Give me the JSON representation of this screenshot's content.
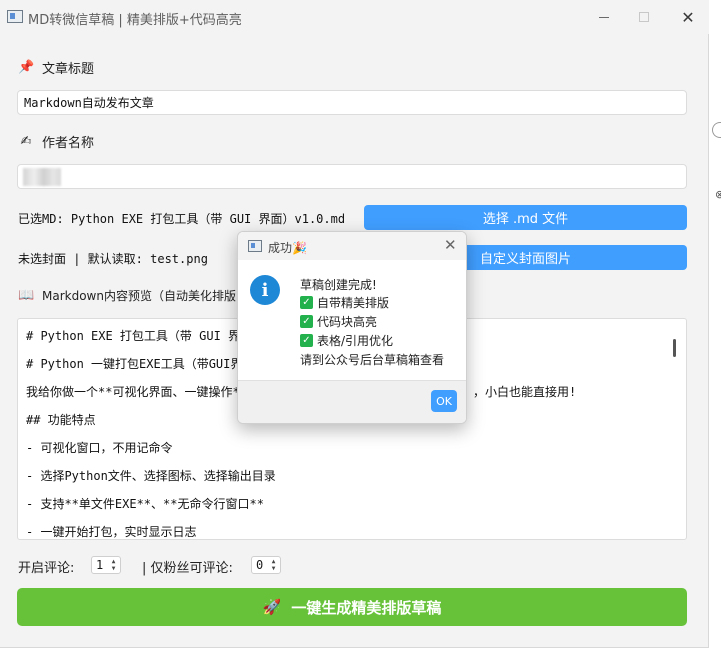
{
  "window": {
    "title": "MD转微信草稿 | 精美排版+代码高亮"
  },
  "form": {
    "title_label": "文章标题",
    "title_icon": "pushpin-icon",
    "title_value": "Markdown自动发布文章",
    "author_label": "作者名称",
    "author_icon": "hand-pen-icon",
    "author_value": "",
    "md_selected_text": "已选MD: Python EXE 打包工具（带 GUI 界面）v1.0.md",
    "select_md_button": "选择 .md 文件",
    "cover_text": "未选封面 | 默认读取: test.png",
    "custom_cover_button": "自定义封面图片",
    "preview_label": "Markdown内容预览（自动美化排版",
    "preview_icon": "book-icon"
  },
  "preview": {
    "lines": [
      "# Python EXE 打包工具（带 GUI 界面）",
      "# Python 一键打包EXE工具（带GUI界面",
      "我给你做一个**可视化界面、一键操作**",
      "## 功能特点",
      "- 可视化窗口，不用记命令",
      "- 选择Python文件、选择图标、选择输出目录",
      "- 支持**单文件EXE**、**无命令行窗口**",
      "- 一键开始打包，实时显示日志"
    ],
    "line3_tail": "，小白也能直接用!"
  },
  "comments": {
    "open_label": "开启评论:",
    "open_value": "1",
    "fans_label": "| 仅粉丝可评论:",
    "fans_value": "0"
  },
  "generate_button": "一键生成精美排版草稿",
  "generate_icon": "rocket-icon",
  "dialog": {
    "title": "成功🎉",
    "message_title": "草稿创建完成!",
    "items": [
      "自带精美排版",
      "代码块高亮",
      "表格/引用优化"
    ],
    "footer_text": "请到公众号后台草稿箱查看",
    "ok_label": "OK"
  },
  "colors": {
    "accent_blue": "#409eff",
    "primary_green": "#67c23a",
    "info_blue": "#1e88d6",
    "check_green": "#22b14c"
  }
}
